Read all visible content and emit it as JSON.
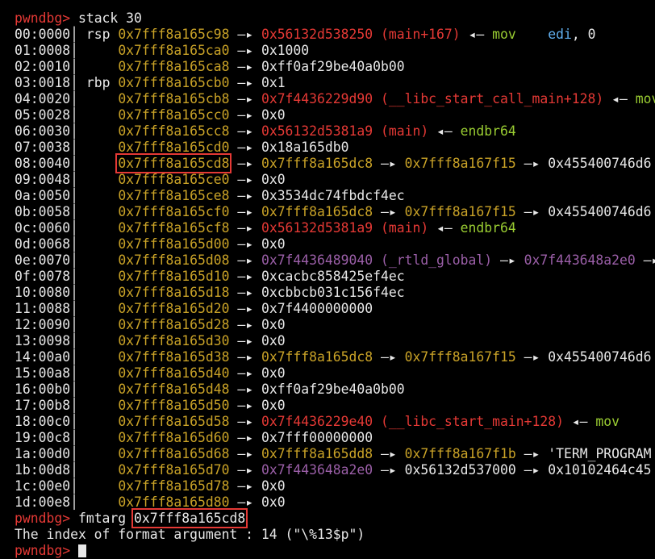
{
  "prompt": "pwndbg>",
  "stack_command": "stack 30",
  "fmtarg_command": "fmtarg",
  "fmtarg_address": "0x7fff8a165cd8",
  "result_line": "The index of format argument : 14 (\"\\%13$p\")",
  "highlight_color": "#e53935",
  "colors": {
    "stack_address": "#c9a227",
    "code_address": "#e53935",
    "data_address": "#9b5fa8",
    "instruction": "#9acd32",
    "operand_register": "#61afef",
    "plain": "#e8e8e8"
  },
  "stack": [
    {
      "offset": "00:0000",
      "reg": "rsp",
      "addr": "0x7fff8a165c98",
      "chain": [
        {
          "t": "a"
        },
        {
          "t": "code",
          "v": "0x56132d538250 (main+167)"
        },
        {
          "t": "l"
        },
        {
          "t": "ins",
          "v": "mov    "
        },
        {
          "t": "op",
          "v": "edi"
        },
        {
          "t": "plain",
          "v": ", 0"
        }
      ]
    },
    {
      "offset": "01:0008",
      "reg": "",
      "addr": "0x7fff8a165ca0",
      "chain": [
        {
          "t": "a"
        },
        {
          "t": "plain",
          "v": "0x1000"
        }
      ]
    },
    {
      "offset": "02:0010",
      "reg": "",
      "addr": "0x7fff8a165ca8",
      "chain": [
        {
          "t": "a"
        },
        {
          "t": "plain",
          "v": "0xff0af29be40a0b00"
        }
      ]
    },
    {
      "offset": "03:0018",
      "reg": "rbp",
      "addr": "0x7fff8a165cb0",
      "chain": [
        {
          "t": "a"
        },
        {
          "t": "plain",
          "v": "0x1"
        }
      ]
    },
    {
      "offset": "04:0020",
      "reg": "",
      "addr": "0x7fff8a165cb8",
      "chain": [
        {
          "t": "a"
        },
        {
          "t": "code",
          "v": "0x7f4436229d90 (__libc_start_call_main+128)"
        },
        {
          "t": "l"
        },
        {
          "t": "ins",
          "v": "mov"
        }
      ]
    },
    {
      "offset": "05:0028",
      "reg": "",
      "addr": "0x7fff8a165cc0",
      "chain": [
        {
          "t": "a"
        },
        {
          "t": "plain",
          "v": "0x0"
        }
      ]
    },
    {
      "offset": "06:0030",
      "reg": "",
      "addr": "0x7fff8a165cc8",
      "chain": [
        {
          "t": "a"
        },
        {
          "t": "code",
          "v": "0x56132d5381a9 (main)"
        },
        {
          "t": "l"
        },
        {
          "t": "ins",
          "v": "endbr64"
        }
      ]
    },
    {
      "offset": "07:0038",
      "reg": "",
      "addr": "0x7fff8a165cd0",
      "chain": [
        {
          "t": "a"
        },
        {
          "t": "plain",
          "v": "0x18a165db0"
        }
      ]
    },
    {
      "offset": "08:0040",
      "reg": "",
      "addr": "0x7fff8a165cd8",
      "highlight": true,
      "chain": [
        {
          "t": "a"
        },
        {
          "t": "stack",
          "v": "0x7fff8a165dc8"
        },
        {
          "t": "a"
        },
        {
          "t": "stack",
          "v": "0x7fff8a167f15"
        },
        {
          "t": "a"
        },
        {
          "t": "plain",
          "v": "0x455400746d6"
        }
      ]
    },
    {
      "offset": "09:0048",
      "reg": "",
      "addr": "0x7fff8a165ce0",
      "chain": [
        {
          "t": "a"
        },
        {
          "t": "plain",
          "v": "0x0"
        }
      ]
    },
    {
      "offset": "0a:0050",
      "reg": "",
      "addr": "0x7fff8a165ce8",
      "chain": [
        {
          "t": "a"
        },
        {
          "t": "plain",
          "v": "0x3534dc74fbdcf4ec"
        }
      ]
    },
    {
      "offset": "0b:0058",
      "reg": "",
      "addr": "0x7fff8a165cf0",
      "chain": [
        {
          "t": "a"
        },
        {
          "t": "stack",
          "v": "0x7fff8a165dc8"
        },
        {
          "t": "a"
        },
        {
          "t": "stack",
          "v": "0x7fff8a167f15"
        },
        {
          "t": "a"
        },
        {
          "t": "plain",
          "v": "0x455400746d6"
        }
      ]
    },
    {
      "offset": "0c:0060",
      "reg": "",
      "addr": "0x7fff8a165cf8",
      "chain": [
        {
          "t": "a"
        },
        {
          "t": "code",
          "v": "0x56132d5381a9 (main)"
        },
        {
          "t": "l"
        },
        {
          "t": "ins",
          "v": "endbr64"
        }
      ]
    },
    {
      "offset": "0d:0068",
      "reg": "",
      "addr": "0x7fff8a165d00",
      "chain": [
        {
          "t": "a"
        },
        {
          "t": "plain",
          "v": "0x0"
        }
      ]
    },
    {
      "offset": "0e:0070",
      "reg": "",
      "addr": "0x7fff8a165d08",
      "chain": [
        {
          "t": "a"
        },
        {
          "t": "data",
          "v": "0x7f4436489040 (_rtld_global)"
        },
        {
          "t": "a"
        },
        {
          "t": "data",
          "v": "0x7f443648a2e0"
        },
        {
          "t": "a"
        },
        {
          "t": "plain",
          "v": "0"
        }
      ]
    },
    {
      "offset": "0f:0078",
      "reg": "",
      "addr": "0x7fff8a165d10",
      "chain": [
        {
          "t": "a"
        },
        {
          "t": "plain",
          "v": "0xcacbc858425ef4ec"
        }
      ]
    },
    {
      "offset": "10:0080",
      "reg": "",
      "addr": "0x7fff8a165d18",
      "chain": [
        {
          "t": "a"
        },
        {
          "t": "plain",
          "v": "0xcbbcb031c156f4ec"
        }
      ]
    },
    {
      "offset": "11:0088",
      "reg": "",
      "addr": "0x7fff8a165d20",
      "chain": [
        {
          "t": "a"
        },
        {
          "t": "plain",
          "v": "0x7f4400000000"
        }
      ]
    },
    {
      "offset": "12:0090",
      "reg": "",
      "addr": "0x7fff8a165d28",
      "chain": [
        {
          "t": "a"
        },
        {
          "t": "plain",
          "v": "0x0"
        }
      ]
    },
    {
      "offset": "13:0098",
      "reg": "",
      "addr": "0x7fff8a165d30",
      "chain": [
        {
          "t": "a"
        },
        {
          "t": "plain",
          "v": "0x0"
        }
      ]
    },
    {
      "offset": "14:00a0",
      "reg": "",
      "addr": "0x7fff8a165d38",
      "chain": [
        {
          "t": "a"
        },
        {
          "t": "stack",
          "v": "0x7fff8a165dc8"
        },
        {
          "t": "a"
        },
        {
          "t": "stack",
          "v": "0x7fff8a167f15"
        },
        {
          "t": "a"
        },
        {
          "t": "plain",
          "v": "0x455400746d6"
        }
      ]
    },
    {
      "offset": "15:00a8",
      "reg": "",
      "addr": "0x7fff8a165d40",
      "chain": [
        {
          "t": "a"
        },
        {
          "t": "plain",
          "v": "0x0"
        }
      ]
    },
    {
      "offset": "16:00b0",
      "reg": "",
      "addr": "0x7fff8a165d48",
      "chain": [
        {
          "t": "a"
        },
        {
          "t": "plain",
          "v": "0xff0af29be40a0b00"
        }
      ]
    },
    {
      "offset": "17:00b8",
      "reg": "",
      "addr": "0x7fff8a165d50",
      "chain": [
        {
          "t": "a"
        },
        {
          "t": "plain",
          "v": "0x0"
        }
      ]
    },
    {
      "offset": "18:00c0",
      "reg": "",
      "addr": "0x7fff8a165d58",
      "chain": [
        {
          "t": "a"
        },
        {
          "t": "code",
          "v": "0x7f4436229e40 (__libc_start_main+128)"
        },
        {
          "t": "l"
        },
        {
          "t": "ins",
          "v": "mov"
        }
      ]
    },
    {
      "offset": "19:00c8",
      "reg": "",
      "addr": "0x7fff8a165d60",
      "chain": [
        {
          "t": "a"
        },
        {
          "t": "plain",
          "v": "0x7fff00000000"
        }
      ]
    },
    {
      "offset": "1a:00d0",
      "reg": "",
      "addr": "0x7fff8a165d68",
      "chain": [
        {
          "t": "a"
        },
        {
          "t": "stack",
          "v": "0x7fff8a165dd8"
        },
        {
          "t": "a"
        },
        {
          "t": "stack",
          "v": "0x7fff8a167f1b"
        },
        {
          "t": "a"
        },
        {
          "t": "plain",
          "v": "'TERM_PROGRAM"
        }
      ]
    },
    {
      "offset": "1b:00d8",
      "reg": "",
      "addr": "0x7fff8a165d70",
      "chain": [
        {
          "t": "a"
        },
        {
          "t": "data",
          "v": "0x7f443648a2e0"
        },
        {
          "t": "a"
        },
        {
          "t": "plain",
          "v": "0x56132d537000"
        },
        {
          "t": "a"
        },
        {
          "t": "plain",
          "v": "0x10102464c45"
        }
      ]
    },
    {
      "offset": "1c:00e0",
      "reg": "",
      "addr": "0x7fff8a165d78",
      "chain": [
        {
          "t": "a"
        },
        {
          "t": "plain",
          "v": "0x0"
        }
      ]
    },
    {
      "offset": "1d:00e8",
      "reg": "",
      "addr": "0x7fff8a165d80",
      "chain": [
        {
          "t": "a"
        },
        {
          "t": "plain",
          "v": "0x0"
        }
      ]
    }
  ]
}
